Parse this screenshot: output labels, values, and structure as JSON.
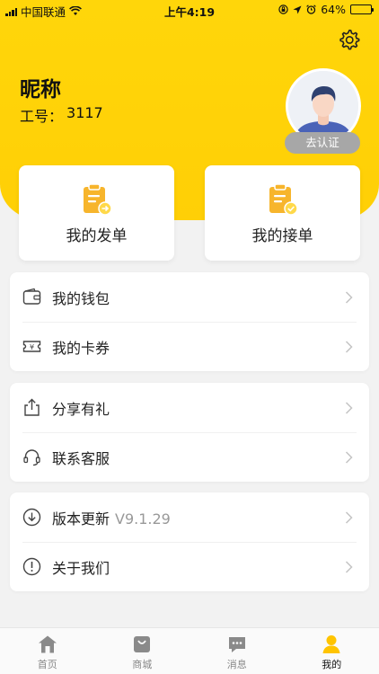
{
  "status_bar": {
    "carrier": "中国联通",
    "time": "上午4:19",
    "battery": "64%",
    "battery_level": 0.64
  },
  "colors": {
    "accent": "#FFD60A",
    "icon_orange": "#F7B52C",
    "tab_inactive": "#8A8A8A"
  },
  "profile": {
    "nickname": "昵称",
    "work_no_label": "工号：",
    "work_no": "3117",
    "verify_label": "去认证"
  },
  "orders": [
    {
      "label": "我的发单",
      "icon": "clipboard-send-icon"
    },
    {
      "label": "我的接单",
      "icon": "clipboard-check-icon"
    }
  ],
  "menu_groups": [
    [
      {
        "label": "我的钱包",
        "icon": "wallet-icon"
      },
      {
        "label": "我的卡券",
        "icon": "coupon-icon"
      }
    ],
    [
      {
        "label": "分享有礼",
        "icon": "share-icon"
      },
      {
        "label": "联系客服",
        "icon": "headset-icon"
      }
    ],
    [
      {
        "label": "版本更新",
        "version": "V9.1.29",
        "icon": "download-icon"
      },
      {
        "label": "关于我们",
        "icon": "info-icon"
      }
    ]
  ],
  "tabs": [
    {
      "label": "首页",
      "icon": "home-icon"
    },
    {
      "label": "商城",
      "icon": "shopping-bag-icon"
    },
    {
      "label": "消息",
      "icon": "message-icon"
    },
    {
      "label": "我的",
      "icon": "user-icon",
      "active": true
    }
  ]
}
